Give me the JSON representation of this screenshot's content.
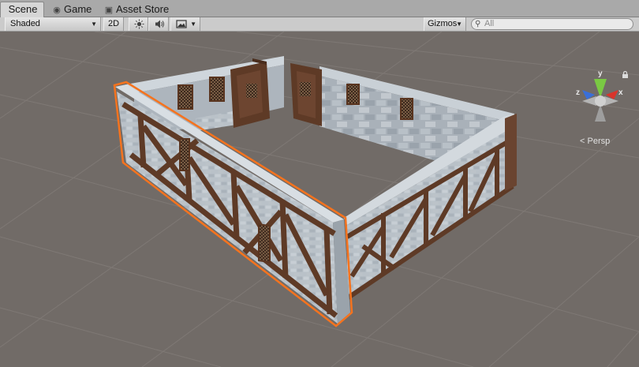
{
  "tabs": [
    {
      "label": "Scene",
      "icon": "scene-icon",
      "active": true
    },
    {
      "label": "Game",
      "icon": "game-icon",
      "active": false
    },
    {
      "label": "Asset Store",
      "icon": "asset-store-icon",
      "active": false
    }
  ],
  "toolbar": {
    "shading_mode": "Shaded",
    "mode_2d": "2D",
    "lighting_icon": "sun-icon",
    "audio_icon": "speaker-icon",
    "effects_icon": "image-icon",
    "gizmos_label": "Gizmos",
    "search_placeholder": "All"
  },
  "gizmo": {
    "y": "y",
    "x": "x",
    "z": "z",
    "projection_label": "Persp",
    "colors": {
      "x": "#d9342b",
      "y": "#7ac943",
      "z": "#3a6fd8"
    }
  },
  "scene": {
    "background": "#716b67",
    "grid_color": "#8a8480",
    "selection_outline": "#f5731e"
  }
}
